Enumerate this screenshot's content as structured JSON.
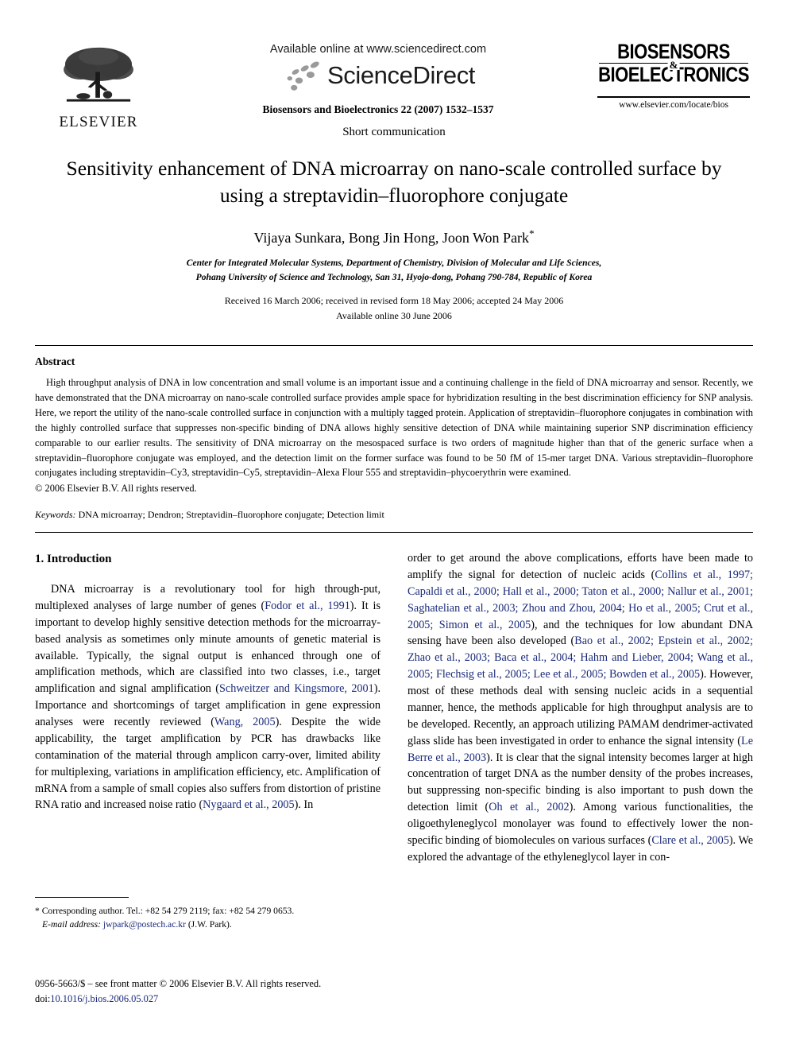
{
  "masthead": {
    "publisher_name": "ELSEVIER",
    "available_online": "Available online at www.sciencedirect.com",
    "sciencedirect_wordmark": "ScienceDirect",
    "journal_reference": "Biosensors and Bioelectronics 22 (2007) 1532–1537",
    "journal_logo_line1": "BIOSENSORS",
    "journal_logo_amp": "&",
    "journal_logo_line2": "BIOELECTRONICS",
    "journal_url": "www.elsevier.com/locate/bios"
  },
  "article": {
    "type": "Short communication",
    "title": "Sensitivity enhancement of DNA microarray on nano-scale controlled surface by using a streptavidin–fluorophore conjugate",
    "authors": "Vijaya Sunkara, Bong Jin Hong, Joon Won Park",
    "author_footnote_marker": "*",
    "affiliation_line1": "Center for Integrated Molecular Systems, Department of Chemistry, Division of Molecular and Life Sciences,",
    "affiliation_line2": "Pohang University of Science and Technology, San 31, Hyojo-dong, Pohang 790-784, Republic of Korea",
    "history_line1": "Received 16 March 2006; received in revised form 18 May 2006; accepted 24 May 2006",
    "history_line2": "Available online 30 June 2006"
  },
  "abstract": {
    "heading": "Abstract",
    "body": "High throughput analysis of DNA in low concentration and small volume is an important issue and a continuing challenge in the field of DNA microarray and sensor. Recently, we have demonstrated that the DNA microarray on nano-scale controlled surface provides ample space for hybridization resulting in the best discrimination efficiency for SNP analysis. Here, we report the utility of the nano-scale controlled surface in conjunction with a multiply tagged protein. Application of streptavidin–fluorophore conjugates in combination with the highly controlled surface that suppresses non-specific binding of DNA allows highly sensitive detection of DNA while maintaining superior SNP discrimination efficiency comparable to our earlier results. The sensitivity of DNA microarray on the mesospaced surface is two orders of magnitude higher than that of the generic surface when a streptavidin–fluorophore conjugate was employed, and the detection limit on the former surface was found to be 50 fM of 15-mer target DNA. Various streptavidin–fluorophore conjugates including streptavidin–Cy3, streptavidin–Cy5, streptavidin–Alexa Flour 555 and streptavidin–phycoerythrin were examined.",
    "copyright": "© 2006 Elsevier B.V. All rights reserved.",
    "keywords_label": "Keywords:",
    "keywords_value": " DNA microarray; Dendron; Streptavidin–fluorophore conjugate; Detection limit"
  },
  "introduction": {
    "heading": "1.  Introduction",
    "left_column_segments": [
      {
        "text": "DNA microarray is a revolutionary tool for high through-put, multiplexed analyses of large number of genes (",
        "cite": false
      },
      {
        "text": "Fodor et al., 1991",
        "cite": true
      },
      {
        "text": "). It is important to develop highly sensitive detection methods for the microarray-based analysis as sometimes only minute amounts of genetic material is available. Typically, the signal output is enhanced through one of amplification methods, which are classified into two classes, i.e., target amplification and signal amplification (",
        "cite": false
      },
      {
        "text": "Schweitzer and Kingsmore, 2001",
        "cite": true
      },
      {
        "text": "). Importance and shortcomings of target amplification in gene expression analyses were recently reviewed (",
        "cite": false
      },
      {
        "text": "Wang, 2005",
        "cite": true
      },
      {
        "text": "). Despite the wide applicability, the target amplification by PCR has drawbacks like contamination of the material through amplicon carry-over, limited ability for multiplexing, variations in amplification efficiency, etc. Amplification of mRNA from a sample of small copies also suffers from distortion of pristine RNA ratio and increased noise ratio (",
        "cite": false
      },
      {
        "text": "Nygaard et al., 2005",
        "cite": true
      },
      {
        "text": "). In",
        "cite": false
      }
    ],
    "right_column_segments": [
      {
        "text": "order to get around the above complications, efforts have been made to amplify the signal for detection of nucleic acids (",
        "cite": false
      },
      {
        "text": "Collins et al., 1997; Capaldi et al., 2000; Hall et al., 2000; Taton et al., 2000; Nallur et al., 2001; Saghatelian et al., 2003; Zhou and Zhou, 2004; Ho et al., 2005; Crut et al., 2005; Simon et al., 2005",
        "cite": true
      },
      {
        "text": "), and the techniques for low abundant DNA sensing have been also developed (",
        "cite": false
      },
      {
        "text": "Bao et al., 2002; Epstein et al., 2002; Zhao et al., 2003; Baca et al., 2004; Hahm and Lieber, 2004; Wang et al., 2005; Flechsig et al., 2005; Lee et al., 2005; Bowden et al., 2005",
        "cite": true
      },
      {
        "text": "). However, most of these methods deal with sensing nucleic acids in a sequential manner, hence, the methods applicable for high throughput analysis are to be developed. Recently, an approach utilizing PAMAM dendrimer-activated glass slide has been investigated in order to enhance the signal intensity (",
        "cite": false
      },
      {
        "text": "Le Berre et al., 2003",
        "cite": true
      },
      {
        "text": "). It is clear that the signal intensity becomes larger at high concentration of target DNA as the number density of the probes increases, but suppressing non-specific binding is also important to push down the detection limit (",
        "cite": false
      },
      {
        "text": "Oh et al., 2002",
        "cite": true
      },
      {
        "text": "). Among various functionalities, the oligoethyleneglycol monolayer was found to effectively lower the non-specific binding of biomolecules on various surfaces (",
        "cite": false
      },
      {
        "text": "Clare et al., 2005",
        "cite": true
      },
      {
        "text": "). We explored the advantage of the ethyleneglycol layer in con-",
        "cite": false
      }
    ]
  },
  "footnotes": {
    "corresponding_marker": "*",
    "corresponding_text": " Corresponding author. Tel.: +82 54 279 2119; fax: +82 54 279 0653.",
    "email_label": "E-mail address:",
    "email_address": "jwpark@postech.ac.kr",
    "email_owner": " (J.W. Park)."
  },
  "imprint": {
    "issn_line": "0956-5663/$ – see front matter © 2006 Elsevier B.V. All rights reserved.",
    "doi_label": "doi:",
    "doi_value": "10.1016/j.bios.2006.05.027"
  },
  "colors": {
    "citation_blue": "#1a2a7a",
    "text_black": "#000000",
    "page_background": "#ffffff"
  }
}
